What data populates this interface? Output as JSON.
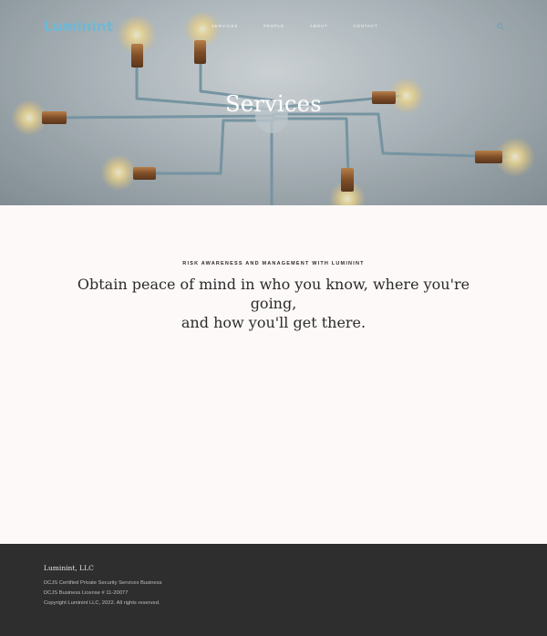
{
  "header": {
    "logo": "Luminint",
    "nav": [
      "SERVICES",
      "PEOPLE",
      "ABOUT",
      "CONTACT"
    ],
    "search_icon": "search-icon"
  },
  "hero": {
    "title": "Services"
  },
  "main": {
    "eyebrow": "RISK AWARENESS AND MANAGEMENT WITH LUMININT",
    "lead_line1": "Obtain peace of mind in who you know, where you're going,",
    "lead_line2": "and how you'll get there."
  },
  "footer": {
    "brand": "Luminint, LLC",
    "lines": [
      "DCJS Certified Private Security Services Business",
      "DCJS Business License # 11-20077",
      "Copyright Luminint LLC, 2022.  All rights reserved."
    ]
  },
  "colors": {
    "logo": "#6db9d6",
    "footer_bg": "#2e2e2e",
    "page_bg": "#fdf9f8"
  }
}
